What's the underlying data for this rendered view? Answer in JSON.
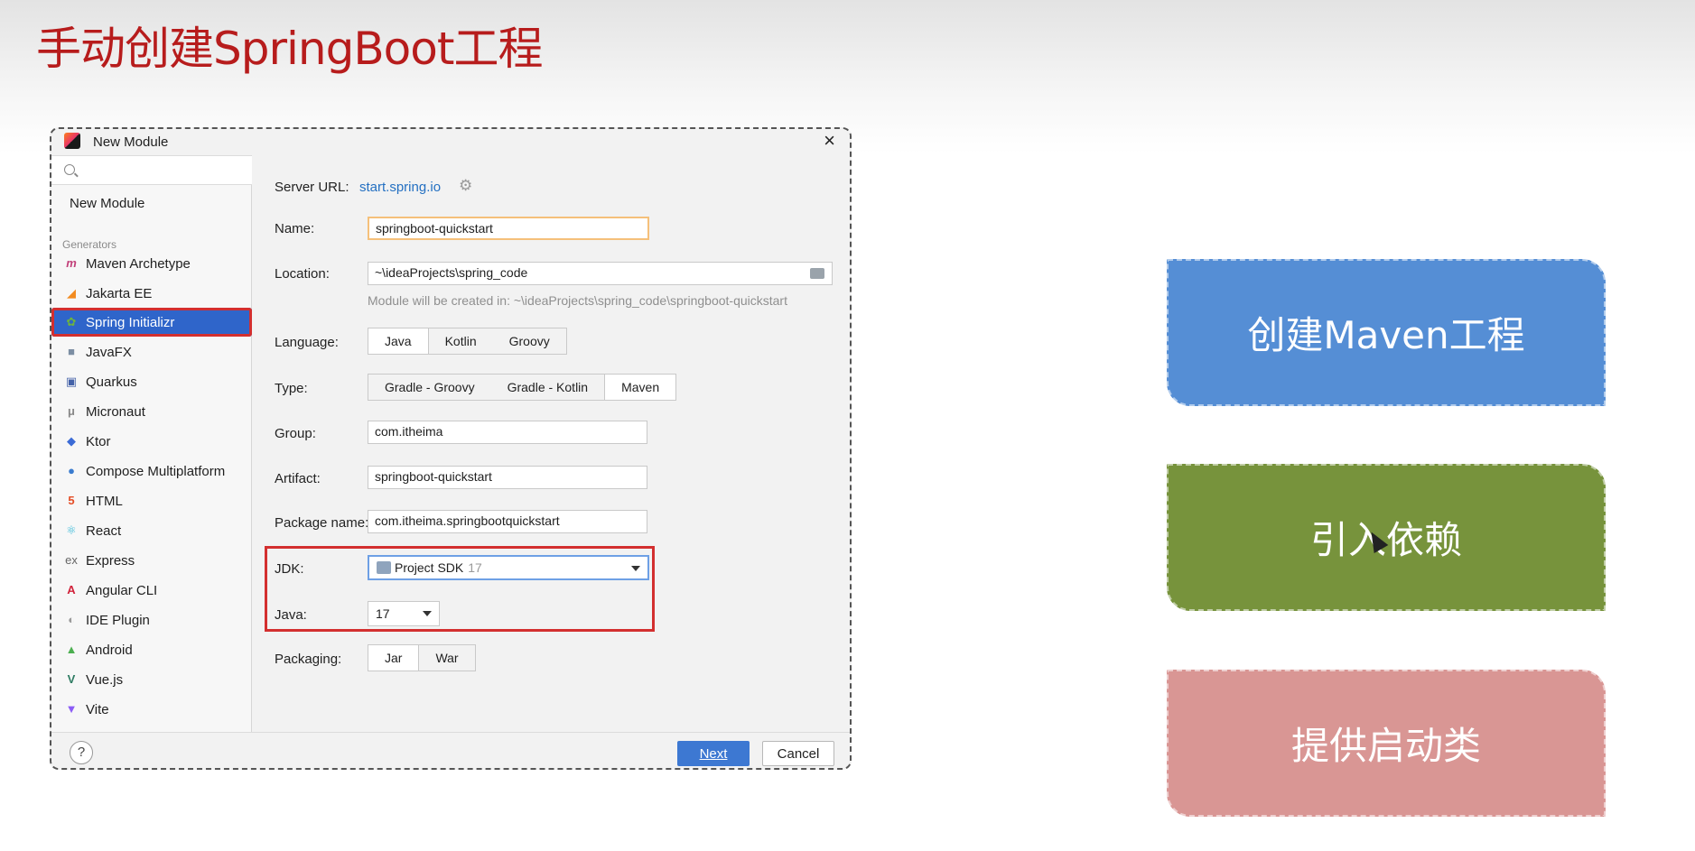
{
  "slide": {
    "title": "手动创建SpringBoot工程"
  },
  "dialog": {
    "title": "New Module",
    "close": "×",
    "sidebar": {
      "search_placeholder": "",
      "new_module": "New Module",
      "group_label": "Generators",
      "items": [
        {
          "label": "Maven Archetype",
          "icon": "maven-icon"
        },
        {
          "label": "Jakarta EE",
          "icon": "jakarta-icon"
        },
        {
          "label": "Spring Initializr",
          "icon": "spring-icon",
          "selected": true
        },
        {
          "label": "JavaFX",
          "icon": "javafx-icon"
        },
        {
          "label": "Quarkus",
          "icon": "quarkus-icon"
        },
        {
          "label": "Micronaut",
          "icon": "micronaut-icon"
        },
        {
          "label": "Ktor",
          "icon": "ktor-icon"
        },
        {
          "label": "Compose Multiplatform",
          "icon": "compose-icon"
        },
        {
          "label": "HTML",
          "icon": "html-icon"
        },
        {
          "label": "React",
          "icon": "react-icon"
        },
        {
          "label": "Express",
          "icon": "express-icon"
        },
        {
          "label": "Angular CLI",
          "icon": "angular-icon"
        },
        {
          "label": "IDE Plugin",
          "icon": "ide-plugin-icon"
        },
        {
          "label": "Android",
          "icon": "android-icon"
        },
        {
          "label": "Vue.js",
          "icon": "vue-icon"
        },
        {
          "label": "Vite",
          "icon": "vite-icon"
        }
      ]
    },
    "form": {
      "server_url_label": "Server URL:",
      "server_url": "start.spring.io",
      "name_label": "Name:",
      "name_value": "springboot-quickstart",
      "location_label": "Location:",
      "location_value": "~\\ideaProjects\\spring_code",
      "location_hint": "Module will be created in: ~\\ideaProjects\\spring_code\\springboot-quickstart",
      "language_label": "Language:",
      "language_options": [
        "Java",
        "Kotlin",
        "Groovy"
      ],
      "language_selected": "Java",
      "type_label": "Type:",
      "type_options": [
        "Gradle - Groovy",
        "Gradle - Kotlin",
        "Maven"
      ],
      "type_selected": "Maven",
      "group_label": "Group:",
      "group_value": "com.itheima",
      "artifact_label": "Artifact:",
      "artifact_value": "springboot-quickstart",
      "package_label": "Package name:",
      "package_value": "com.itheima.springbootquickstart",
      "jdk_label": "JDK:",
      "jdk_value": "Project SDK",
      "jdk_version": "17",
      "java_label": "Java:",
      "java_value": "17",
      "packaging_label": "Packaging:",
      "packaging_options": [
        "Jar",
        "War"
      ],
      "packaging_selected": "Jar"
    },
    "footer": {
      "help": "?",
      "next": "Next",
      "cancel": "Cancel"
    }
  },
  "steps": [
    {
      "label": "创建Maven工程",
      "color": "#558ed5"
    },
    {
      "label": "引入依赖",
      "color": "#77933c"
    },
    {
      "label": "提供启动类",
      "color": "#d99694"
    }
  ]
}
